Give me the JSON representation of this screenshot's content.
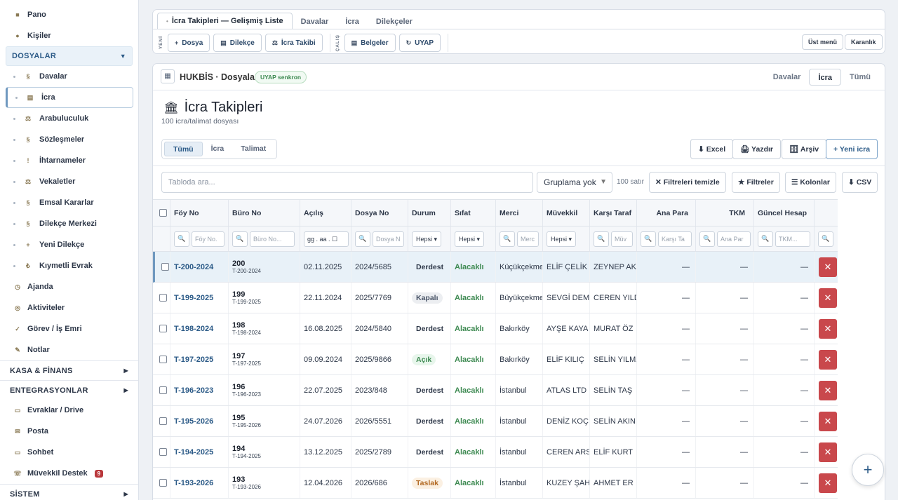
{
  "sidebar": {
    "top": [
      {
        "icon": "■",
        "label": "Pano"
      },
      {
        "icon": "●",
        "label": "Kişiler"
      }
    ],
    "dosyalar": {
      "label": "DOSYALAR",
      "caret": "▼"
    },
    "sub": [
      {
        "icon": "§",
        "label": "Davalar"
      },
      {
        "icon": "▤",
        "label": "İcra"
      },
      {
        "icon": "⚖",
        "label": "Arabuluculuk"
      },
      {
        "icon": "§",
        "label": "Sözleşmeler"
      },
      {
        "icon": "!",
        "label": "İhtarnameler"
      },
      {
        "icon": "⚖",
        "label": "Vekaletler"
      },
      {
        "icon": "§",
        "label": "Emsal Kararlar"
      },
      {
        "icon": "§",
        "label": "Dilekçe Merkezi"
      },
      {
        "icon": "+",
        "label": "Yeni Dilekçe"
      },
      {
        "icon": "₺",
        "label": "Kıymetli Evrak"
      }
    ],
    "mid": [
      {
        "icon": "◷",
        "label": "Ajanda"
      },
      {
        "icon": "◎",
        "label": "Aktiviteler"
      },
      {
        "icon": "✓",
        "label": "Görev / İş Emri"
      },
      {
        "icon": "✎",
        "label": "Notlar"
      }
    ],
    "kasa": {
      "label": "KASA & FİNANS",
      "caret": "▶"
    },
    "entegrasyon": {
      "label": "ENTEGRASYONLAR",
      "caret": "▶"
    },
    "bottom": [
      {
        "icon": "▭",
        "label": "Evraklar / Drive"
      },
      {
        "icon": "✉",
        "label": "Posta"
      },
      {
        "icon": "▭",
        "label": "Sohbet"
      },
      {
        "icon": "☏",
        "label": "Müvekkil Destek",
        "badge": "9"
      }
    ],
    "sistem": {
      "label": "SİSTEM",
      "caret": "▶"
    }
  },
  "toolbar": {
    "tabs": [
      {
        "label": "İcra Takipleri — Gelişmiş Liste",
        "marker": "•"
      },
      {
        "label": "Davalar"
      },
      {
        "label": "İcra"
      },
      {
        "label": "Dilekçeler"
      }
    ],
    "yeni_label": "YENİ",
    "calis_label": "ÇALIŞ",
    "yeni": [
      {
        "icon": "+",
        "label": "Dosya"
      },
      {
        "icon": "▤",
        "label": "Dilekçe"
      },
      {
        "icon": "⚖",
        "label": "İcra Takibi"
      }
    ],
    "calis": [
      {
        "icon": "▤",
        "label": "Belgeler"
      },
      {
        "icon": "↻",
        "label": "UYAP"
      }
    ],
    "ust_menu": "Üst menü",
    "karanlik": "Karanlık"
  },
  "panel": {
    "icon": "▦",
    "title": "HUKBİS · Dosyalar",
    "sync": "UYAP senkron",
    "seg_right": [
      "Davalar",
      "İcra",
      "Tümü"
    ],
    "heading_icon": "🏛",
    "heading": "İcra Takipleri",
    "subtitle": "100 icra/talimat dosyası",
    "seg_left": [
      "Tümü",
      "İcra",
      "Talimat"
    ],
    "actions": {
      "excel": "⬇ Excel",
      "yazdir": "🖨 Yazdır",
      "arsiv": "🗄 Arşiv",
      "yeni": "+ Yeni icra"
    },
    "search_placeholder": "Tabloda ara...",
    "grouping": "Gruplama yok",
    "grouping_caret": "▼",
    "rows": "100 satır",
    "controls": {
      "temizle": "✕ Filtreleri temizle",
      "filtreler": "★ Filtreler",
      "kolonlar": "☰ Kolonlar",
      "csv": "⬇ CSV"
    }
  },
  "table": {
    "headers": [
      "Föy No",
      "Büro No",
      "Açılış",
      "Dosya No",
      "Durum",
      "Sıfat",
      "Merci",
      "Müvekkil",
      "Karşı Taraf",
      "Ana Para",
      "TKM",
      "Güncel Hesap"
    ],
    "filters": {
      "search_icon": "🔍",
      "foy": "Föy No.",
      "buro": "Büro No...",
      "acilis": "gg . aa . ☐",
      "dosya": "Dosya N",
      "durum": "Hepsi ▾",
      "sifat": "Hepsi ▾",
      "merci": "Merc",
      "muvekkil": "Hepsi ▾",
      "karsi": "Müv",
      "ana": "Karşı Ta",
      "tkm": "Ana Par",
      "guncel": "TKM..."
    },
    "rows": [
      {
        "foy": "T-200-2024",
        "buro": "200",
        "buro_sub": "T-200-2024",
        "acilis": "02.11.2025",
        "dosya": "2024/5685",
        "durum": "Derdest",
        "durum_kind": "derdest",
        "sifat": "Alacaklı",
        "merci": "Küçükçekmece",
        "muvekkil": "ELİF ÇELİK",
        "karsi": "ZEYNEP AK",
        "ana": "—",
        "tkm": "—",
        "guncel": "—"
      },
      {
        "foy": "T-199-2025",
        "buro": "199",
        "buro_sub": "T-199-2025",
        "acilis": "22.11.2024",
        "dosya": "2025/7769",
        "durum": "Kapalı",
        "durum_kind": "kapali",
        "sifat": "Alacaklı",
        "merci": "Büyükçekmece",
        "muvekkil": "SEVGİ DEMİR",
        "karsi": "CEREN YILDIZ",
        "ana": "—",
        "tkm": "—",
        "guncel": "—"
      },
      {
        "foy": "T-198-2024",
        "buro": "198",
        "buro_sub": "T-198-2024",
        "acilis": "16.08.2025",
        "dosya": "2024/5840",
        "durum": "Derdest",
        "durum_kind": "derdest",
        "sifat": "Alacaklı",
        "merci": "Bakırköy",
        "muvekkil": "AYŞE KAYA",
        "karsi": "MURAT ÖZ",
        "ana": "—",
        "tkm": "—",
        "guncel": "—"
      },
      {
        "foy": "T-197-2025",
        "buro": "197",
        "buro_sub": "T-197-2025",
        "acilis": "09.09.2024",
        "dosya": "2025/9866",
        "durum": "Açık",
        "durum_kind": "acik",
        "sifat": "Alacaklı",
        "merci": "Bakırköy",
        "muvekkil": "ELİF KILIÇ",
        "karsi": "SELİN YILMAZ",
        "ana": "—",
        "tkm": "—",
        "guncel": "—"
      },
      {
        "foy": "T-196-2023",
        "buro": "196",
        "buro_sub": "T-196-2023",
        "acilis": "22.07.2025",
        "dosya": "2023/848",
        "durum": "Derdest",
        "durum_kind": "derdest",
        "sifat": "Alacaklı",
        "merci": "İstanbul",
        "muvekkil": "ATLAS LTD",
        "karsi": "SELİN TAŞ",
        "ana": "—",
        "tkm": "—",
        "guncel": "—"
      },
      {
        "foy": "T-195-2026",
        "buro": "195",
        "buro_sub": "T-195-2026",
        "acilis": "24.07.2026",
        "dosya": "2026/5551",
        "durum": "Derdest",
        "durum_kind": "derdest",
        "sifat": "Alacaklı",
        "merci": "İstanbul",
        "muvekkil": "DENİZ KOÇ",
        "karsi": "SELİN AKIN",
        "ana": "—",
        "tkm": "—",
        "guncel": "—"
      },
      {
        "foy": "T-194-2025",
        "buro": "194",
        "buro_sub": "T-194-2025",
        "acilis": "13.12.2025",
        "dosya": "2025/2789",
        "durum": "Derdest",
        "durum_kind": "derdest",
        "sifat": "Alacaklı",
        "merci": "İstanbul",
        "muvekkil": "CEREN ARSLAN",
        "karsi": "ELİF KURT",
        "ana": "—",
        "tkm": "—",
        "guncel": "—"
      },
      {
        "foy": "T-193-2026",
        "buro": "193",
        "buro_sub": "T-193-2026",
        "acilis": "12.04.2026",
        "dosya": "2026/686",
        "durum": "Taslak",
        "durum_kind": "taslak",
        "sifat": "Alacaklı",
        "merci": "İstanbul",
        "muvekkil": "KUZEY ŞAHİN",
        "karsi": "AHMET ER",
        "ana": "—",
        "tkm": "—",
        "guncel": "—"
      }
    ],
    "delete_icon": "✕"
  },
  "fab": "+"
}
